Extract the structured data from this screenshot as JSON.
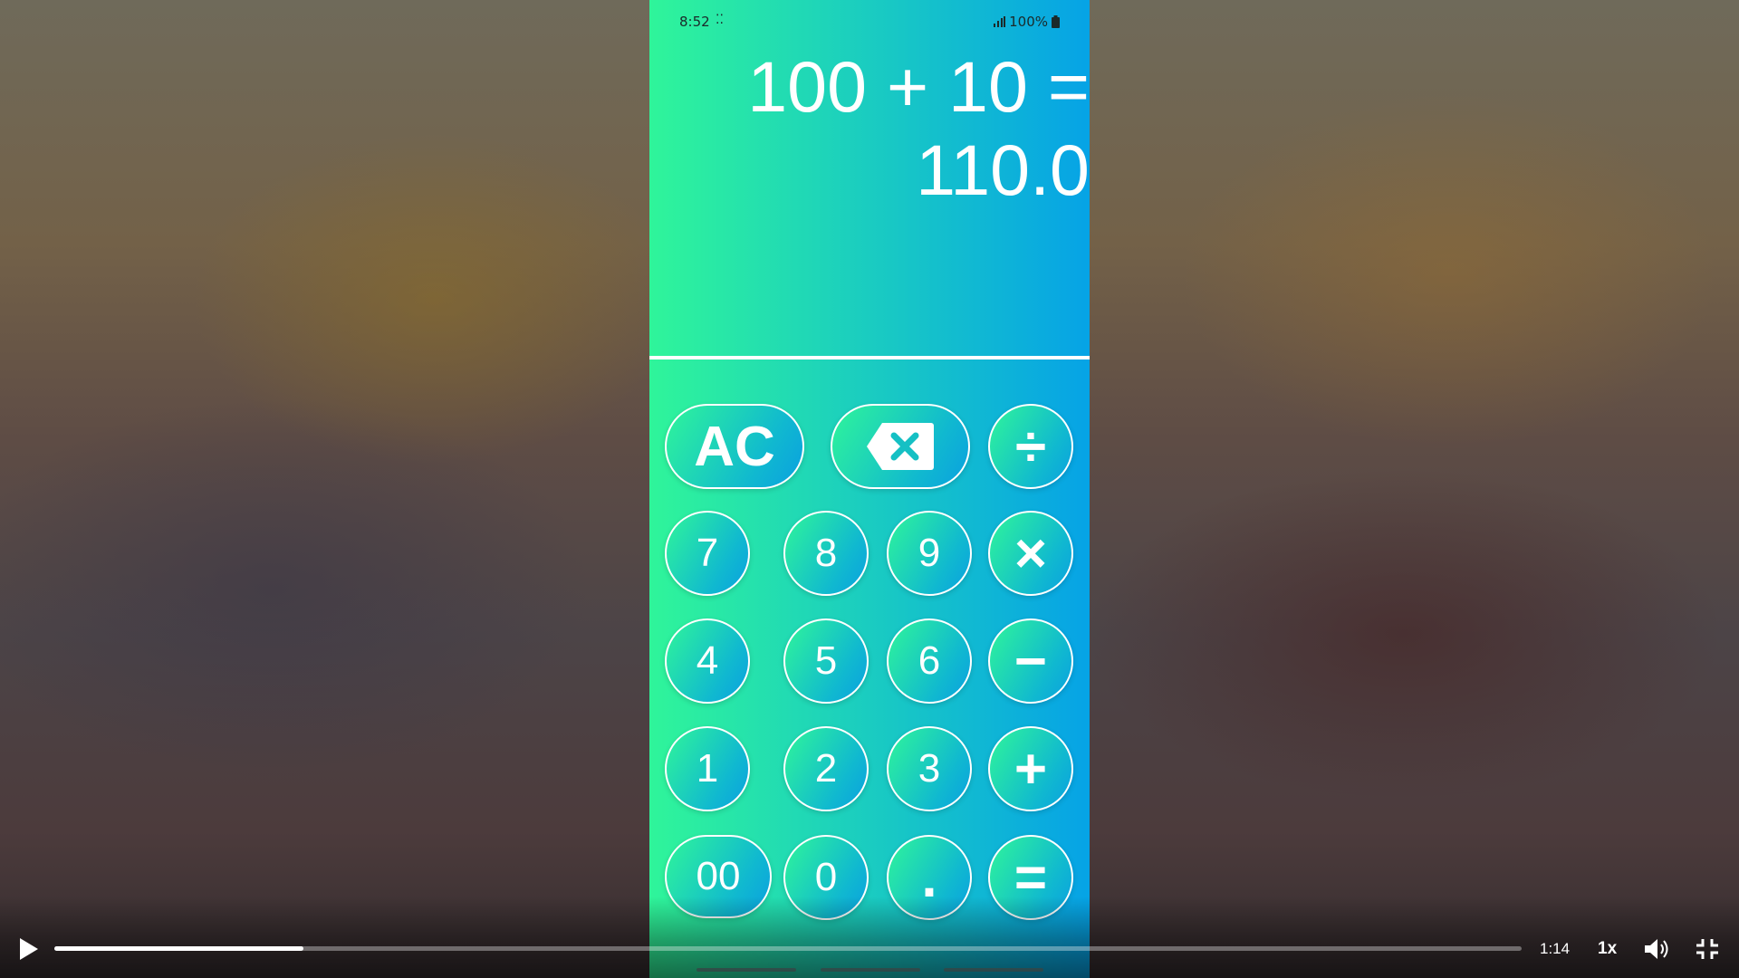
{
  "status_bar": {
    "time": "8:52",
    "dots": "⁚⁚",
    "battery": "100%"
  },
  "display": {
    "expression": "100 + 10 =",
    "result": "110.0"
  },
  "keypad": {
    "clear": "AC",
    "backspace_icon": "backspace-icon",
    "divide": "÷",
    "multiply": "×",
    "minus": "−",
    "plus": "+",
    "equals": "=",
    "seven": "7",
    "eight": "8",
    "nine": "9",
    "four": "4",
    "five": "5",
    "six": "6",
    "one": "1",
    "two": "2",
    "three": "3",
    "double_zero": "00",
    "zero": "0",
    "dot": "."
  },
  "player": {
    "time": "1:14",
    "speed": "1x",
    "progress": 0.17
  },
  "colors": {
    "gradient_start": "#2ff59a",
    "gradient_end": "#06a3e6"
  }
}
